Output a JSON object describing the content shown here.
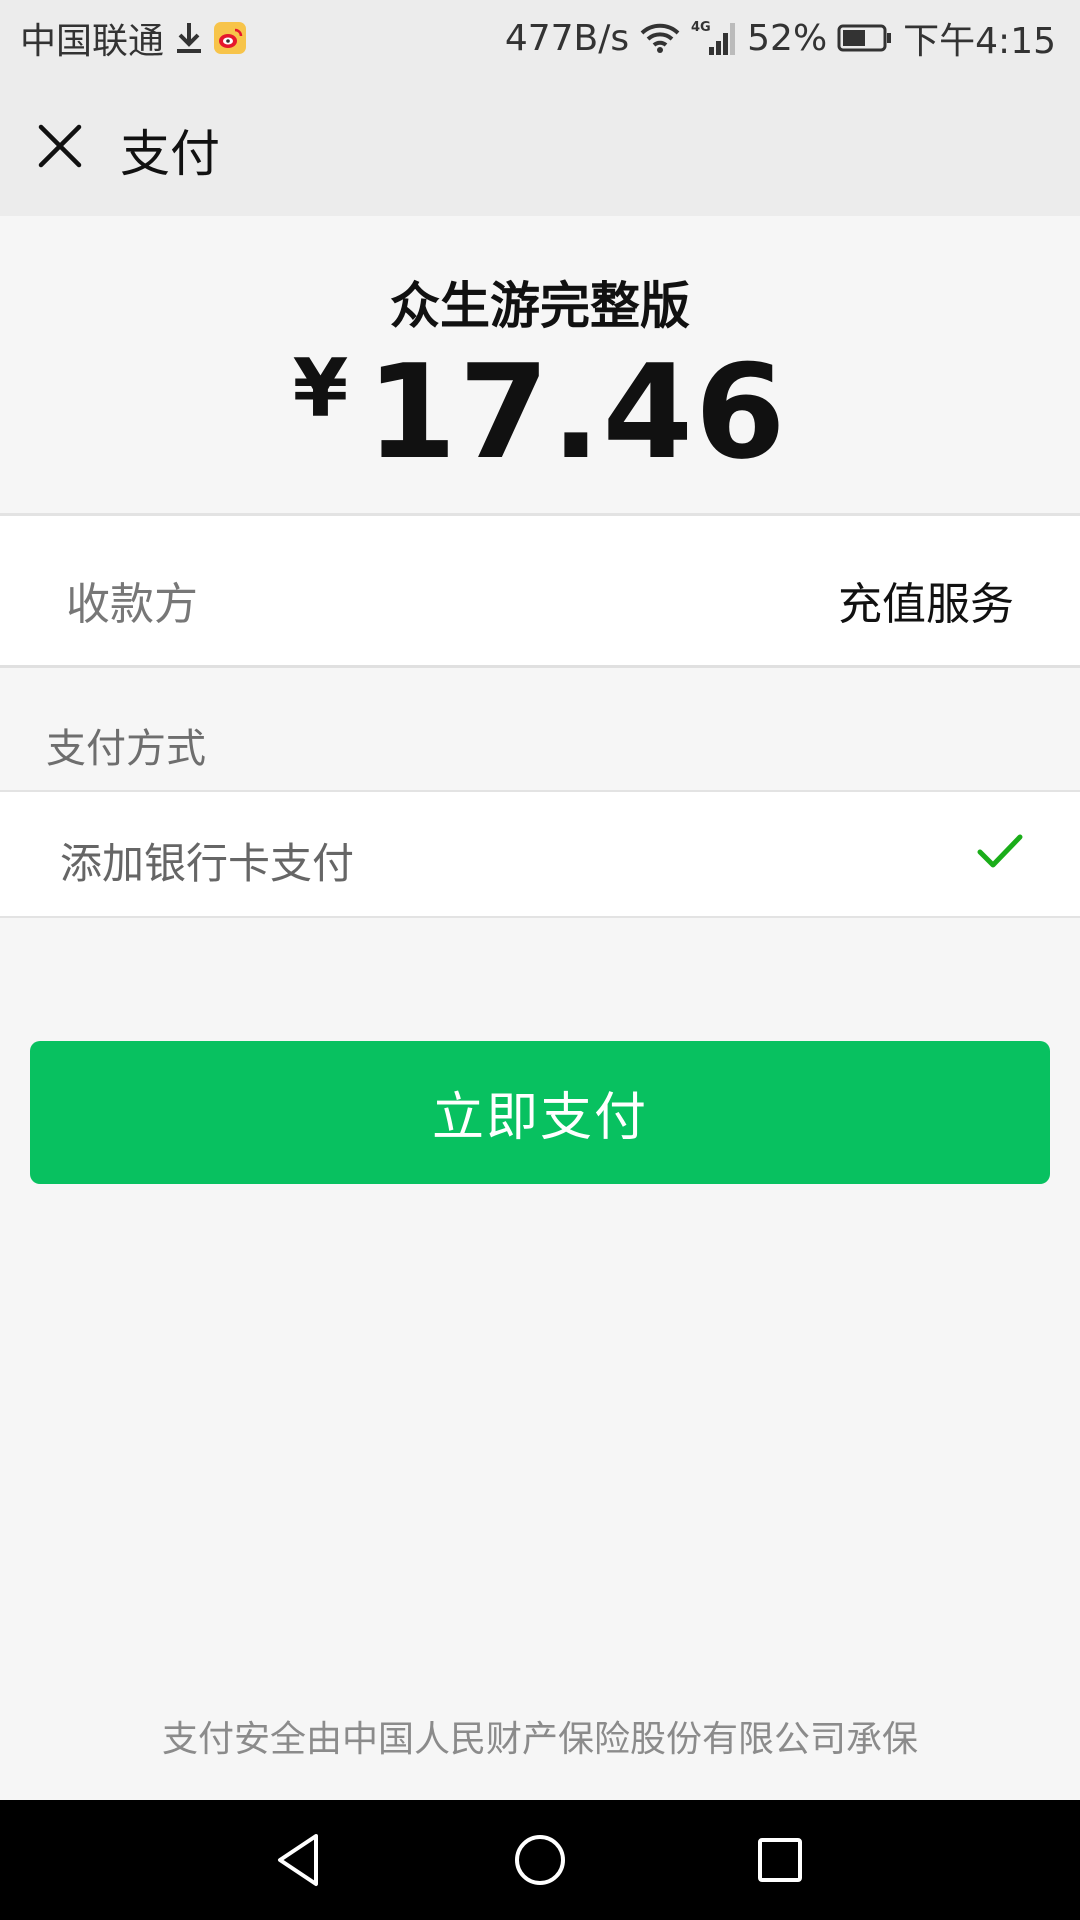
{
  "status_bar": {
    "carrier": "中国联通",
    "net_speed": "477B/s",
    "network_type": "4G",
    "battery": "52%",
    "time": "下午4:15",
    "icons": [
      "download-icon",
      "weibo-icon",
      "wifi-icon",
      "signal-icon",
      "battery-icon"
    ]
  },
  "nav": {
    "title": "支付",
    "close_icon": "close-icon"
  },
  "order": {
    "merchant": "众生游完整版",
    "currency": "¥",
    "amount": "17.46"
  },
  "payee": {
    "label": "收款方",
    "value": "充值服务"
  },
  "payment_method": {
    "title": "支付方式",
    "option": "添加银行卡支付",
    "selected": true,
    "check_color": "#1aad19"
  },
  "pay_button": {
    "label": "立即支付",
    "color": "#08c160"
  },
  "footer": {
    "note": "支付安全由中国人民财产保险股份有限公司承保"
  },
  "system_nav": {
    "buttons": [
      "back-icon",
      "home-icon",
      "recent-apps-icon"
    ]
  }
}
